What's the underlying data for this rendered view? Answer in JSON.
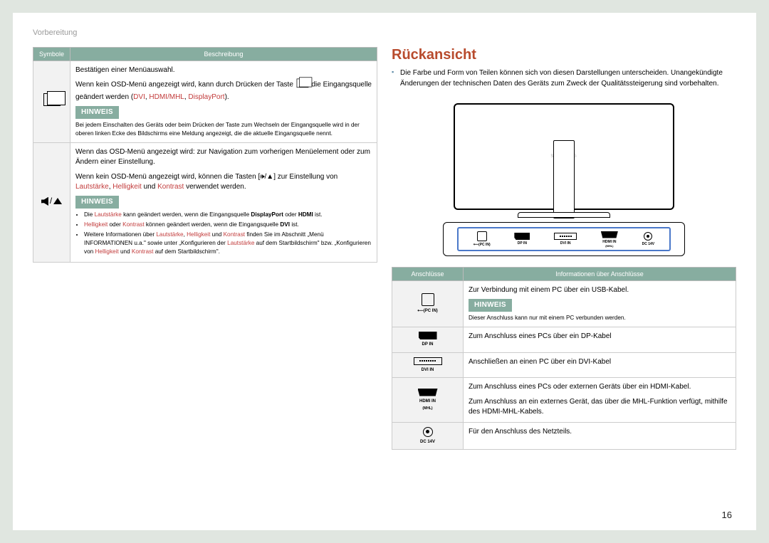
{
  "section_header": "Vorbereitung",
  "page_number": "16",
  "left_table": {
    "headers": {
      "symbols": "Symbole",
      "description": "Beschreibung"
    },
    "row1": {
      "confirm_line": "Bestätigen einer Menüauswahl.",
      "no_osd_1a": "Wenn kein OSD-Menü angezeigt wird, kann durch Drücken der Taste ",
      "no_osd_1b": " die Eingangsquelle geändert werden (",
      "src_dvi": "DVI",
      "src_sep1": ", ",
      "src_hdmi": "HDMI/MHL",
      "src_sep2": ", ",
      "src_dp": "DisplayPort",
      "src_close": ").",
      "hinweis_label": "HINWEIS",
      "hinweis_text": "Bei jedem Einschalten des Geräts oder beim Drücken der Taste        zum Wechseln der Eingangsquelle wird in der oberen linken Ecke des Bildschirms eine Meldung angezeigt, die die aktuelle Eingangsquelle nennt."
    },
    "row2": {
      "osd_shown": "Wenn das OSD-Menü angezeigt wird: zur Navigation zum vorherigen Menüelement oder zum Ändern einer Einstellung.",
      "no_osd_pre": "Wenn kein OSD-Menü angezeigt wird, können die Tasten [🕪/▲] zur Einstellung von ",
      "laut": "Lautstärke",
      "sep_a": ", ",
      "hell": "Helligkeit",
      "sep_b": " und ",
      "kont": "Kontrast",
      "no_osd_post": " verwendet werden.",
      "hinweis_label": "HINWEIS",
      "b1_a": "Die ",
      "b1_laut": "Lautstärke",
      "b1_b": " kann geändert werden, wenn die Eingangsquelle ",
      "b1_dp": "DisplayPort",
      "b1_c": " oder ",
      "b1_hdmi": "HDMI",
      "b1_d": " ist.",
      "b2_hell": "Helligkeit",
      "b2_a": " oder ",
      "b2_kont": "Kontrast",
      "b2_b": " können geändert werden, wenn die Eingangsquelle ",
      "b2_dvi": "DVI",
      "b2_c": " ist.",
      "b3_a": "Weitere Informationen über ",
      "b3_laut": "Lautstärke",
      "b3_b": ", ",
      "b3_hell": "Helligkeit",
      "b3_c": " und ",
      "b3_kont": "Kontrast",
      "b3_d": " finden Sie im Abschnitt „Menü INFORMATIONEN u.a.\" sowie unter „Konfigurieren der ",
      "b3_laut2": "Lautstärke",
      "b3_e": " auf dem Startbildschirm\" bzw. „Konfigurieren von ",
      "b3_hell2": "Helligkeit",
      "b3_f": " und ",
      "b3_kont2": "Kontrast",
      "b3_g": " auf dem Startbildschirm\"."
    }
  },
  "right": {
    "title": "Rückansicht",
    "intro": "Die Farbe und Form von Teilen können sich von diesen Darstellungen unterscheiden. Unangekündigte Änderungen der technischen Daten des Geräts zum Zweck der Qualitätssteigerung sind vorbehalten.",
    "brand": "SAMSUNG",
    "ports_labels": {
      "usb": "⟵(PC IN)",
      "dp": "DP IN",
      "dvi": "DVI IN",
      "hdmi": "HDMI IN",
      "hdmi_sub": "(MHL)",
      "dc": "DC 14V"
    },
    "conn_table": {
      "headers": {
        "conn": "Anschlüsse",
        "info": "Informationen über Anschlüsse"
      },
      "usb": {
        "label_top": "⟵(PC IN)",
        "desc": "Zur Verbindung mit einem PC über ein USB-Kabel.",
        "hinweis_label": "HINWEIS",
        "hinweis_text": "Dieser Anschluss kann nur mit einem PC verbunden werden."
      },
      "dp": {
        "label": "DP IN",
        "desc": "Zum Anschluss eines PCs über ein DP-Kabel"
      },
      "dvi": {
        "label": "DVI IN",
        "desc": "Anschließen an einen PC über ein DVI-Kabel"
      },
      "hdmi": {
        "label": "HDMI IN",
        "sub": "(MHL)",
        "desc1": "Zum Anschluss eines PCs oder externen Geräts über ein HDMI-Kabel.",
        "desc2": "Zum Anschluss an ein externes Gerät, das über die MHL-Funktion verfügt, mithilfe des HDMI-MHL-Kabels."
      },
      "dc": {
        "label": "DC 14V",
        "desc": "Für den Anschluss des Netzteils."
      }
    }
  }
}
